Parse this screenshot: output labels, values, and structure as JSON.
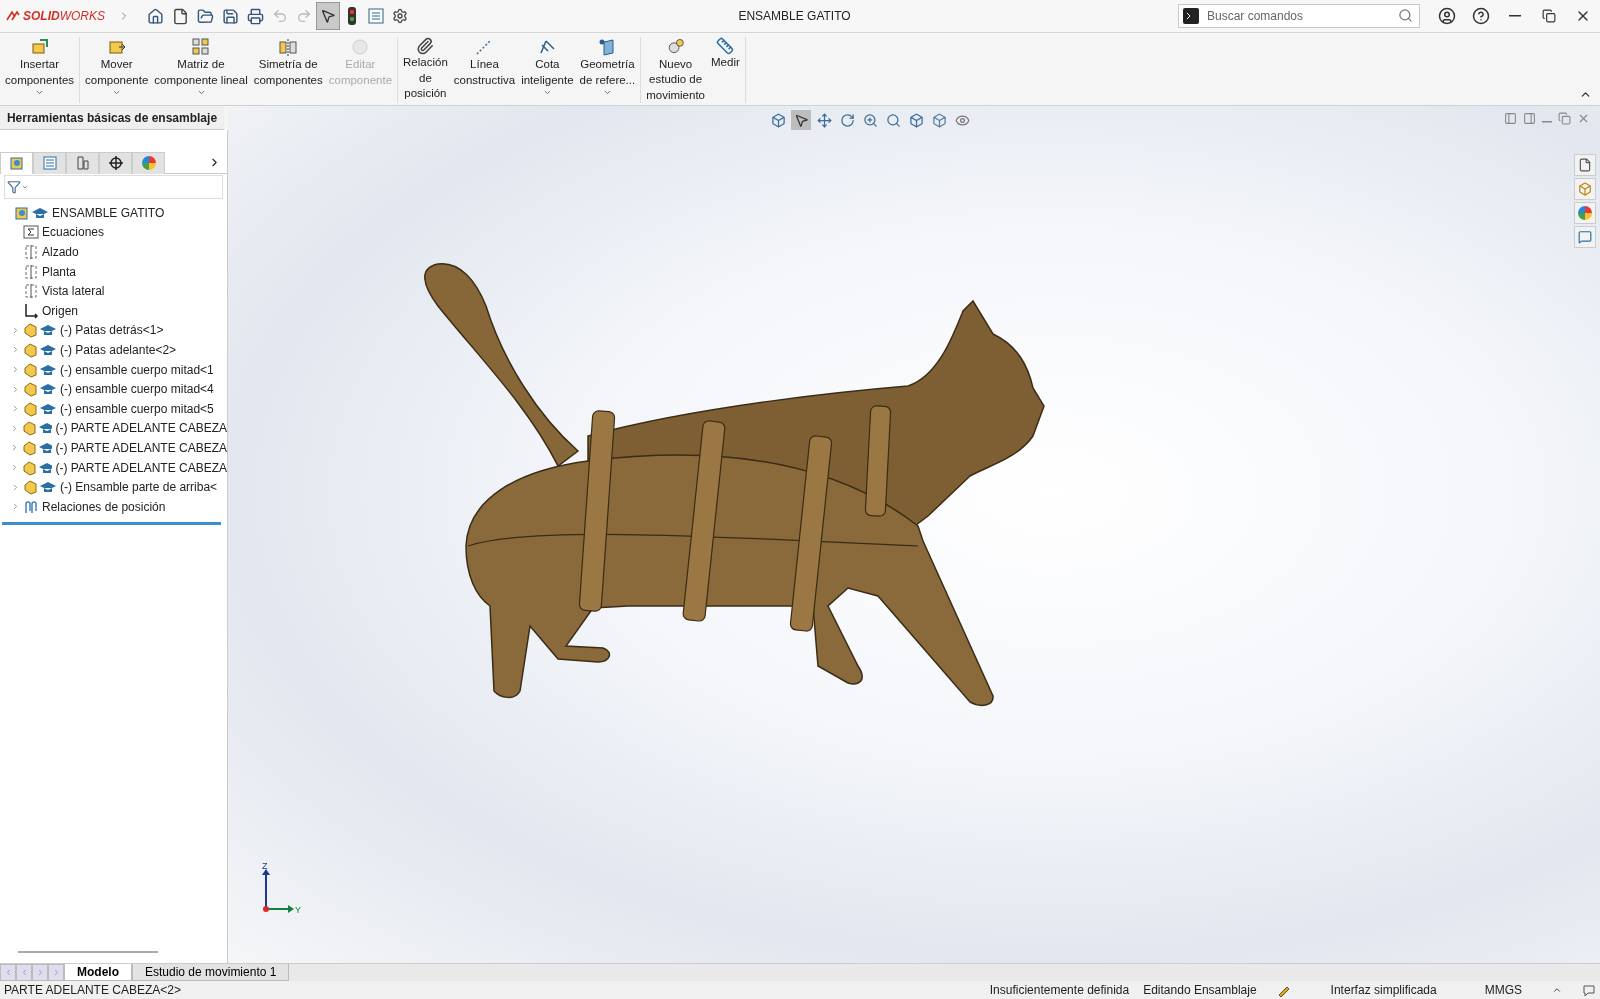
{
  "title_bar": {
    "brand_bold": "SOLID",
    "brand_rest": "WORKS",
    "title": "ENSAMBLE GATITO",
    "search": {
      "placeholder": "Buscar comandos"
    }
  },
  "ribbon": {
    "groups": [
      {
        "commands": [
          {
            "kind": "insert",
            "lines": [
              "Insertar",
              "componentes"
            ],
            "disabled": false,
            "dropdown": true
          }
        ]
      },
      {
        "commands": [
          {
            "kind": "move",
            "lines": [
              "Mover",
              "componente"
            ],
            "disabled": false,
            "dropdown": true
          },
          {
            "kind": "pattern",
            "lines": [
              "Matriz de",
              "componente lineal"
            ],
            "disabled": false,
            "dropdown": true
          },
          {
            "kind": "mirror",
            "lines": [
              "Simetría de",
              "componentes"
            ],
            "disabled": false,
            "dropdown": false
          },
          {
            "kind": "edit",
            "lines": [
              "Editar",
              "componente"
            ],
            "disabled": true,
            "dropdown": false
          }
        ]
      },
      {
        "commands": [
          {
            "kind": "mate",
            "lines": [
              "Relación",
              "de",
              "posición"
            ],
            "disabled": false,
            "dropdown": false
          },
          {
            "kind": "line",
            "lines": [
              "Línea",
              "constructiva"
            ],
            "disabled": false,
            "dropdown": false
          },
          {
            "kind": "dimension",
            "lines": [
              "Cota",
              "inteligente"
            ],
            "disabled": false,
            "dropdown": true
          },
          {
            "kind": "geometry",
            "lines": [
              "Geometría",
              "de refere..."
            ],
            "disabled": false,
            "dropdown": true
          }
        ]
      },
      {
        "commands": [
          {
            "kind": "motion",
            "lines": [
              "Nuevo",
              "estudio de",
              "movimiento"
            ],
            "disabled": false,
            "dropdown": false
          },
          {
            "kind": "measure",
            "lines": [
              "Medir"
            ],
            "disabled": false,
            "dropdown": false
          }
        ]
      }
    ],
    "tab": "Herramientas básicas de ensamblaje"
  },
  "feature_manager": {
    "tabs": [
      {
        "kind": "tree",
        "selected": true
      },
      {
        "kind": "property",
        "selected": false
      },
      {
        "kind": "config",
        "selected": false
      },
      {
        "kind": "dimxpert",
        "selected": false
      },
      {
        "kind": "display",
        "selected": false
      }
    ],
    "tree": [
      {
        "kind": "root",
        "label": "ENSAMBLE GATITO",
        "children": [
          {
            "kind": "equations",
            "label": "Ecuaciones"
          },
          {
            "kind": "plane",
            "label": "Alzado"
          },
          {
            "kind": "plane",
            "label": "Planta"
          },
          {
            "kind": "plane",
            "label": "Vista lateral"
          },
          {
            "kind": "origin",
            "label": "Origen"
          },
          {
            "kind": "component",
            "label": "(-) Patas detrás<1>",
            "expanded": false
          },
          {
            "kind": "component",
            "label": "(-) Patas adelante<2>",
            "expanded": false
          },
          {
            "kind": "component",
            "label": "(-) ensamble cuerpo mitad<1",
            "expanded": false
          },
          {
            "kind": "component",
            "label": "(-) ensamble cuerpo mitad<4",
            "expanded": false
          },
          {
            "kind": "component",
            "label": "(-) ensamble cuerpo mitad<5",
            "expanded": false
          },
          {
            "kind": "component",
            "label": "(-) PARTE ADELANTE CABEZA",
            "expanded": false
          },
          {
            "kind": "component",
            "label": "(-) PARTE ADELANTE CABEZA",
            "expanded": false
          },
          {
            "kind": "component",
            "label": "(-) PARTE ADELANTE CABEZA",
            "expanded": false
          },
          {
            "kind": "component",
            "label": "(-) Ensamble parte de arriba<",
            "expanded": false
          },
          {
            "kind": "mates",
            "label": "Relaciones de posición",
            "expanded": false
          }
        ]
      }
    ]
  },
  "viewport": {
    "triad": {
      "z": "Z",
      "y": "Y"
    }
  },
  "bottom_tabs": [
    {
      "label": "Modelo",
      "selected": true
    },
    {
      "label": "Estudio de movimiento 1",
      "selected": false
    }
  ],
  "status_bar": {
    "message": "PARTE ADELANTE CABEZA<2>",
    "definition": "Insuficientemente definida",
    "mode": "Editando Ensamblaje",
    "interface": "Interfaz simplificada",
    "units": "MMGS"
  }
}
